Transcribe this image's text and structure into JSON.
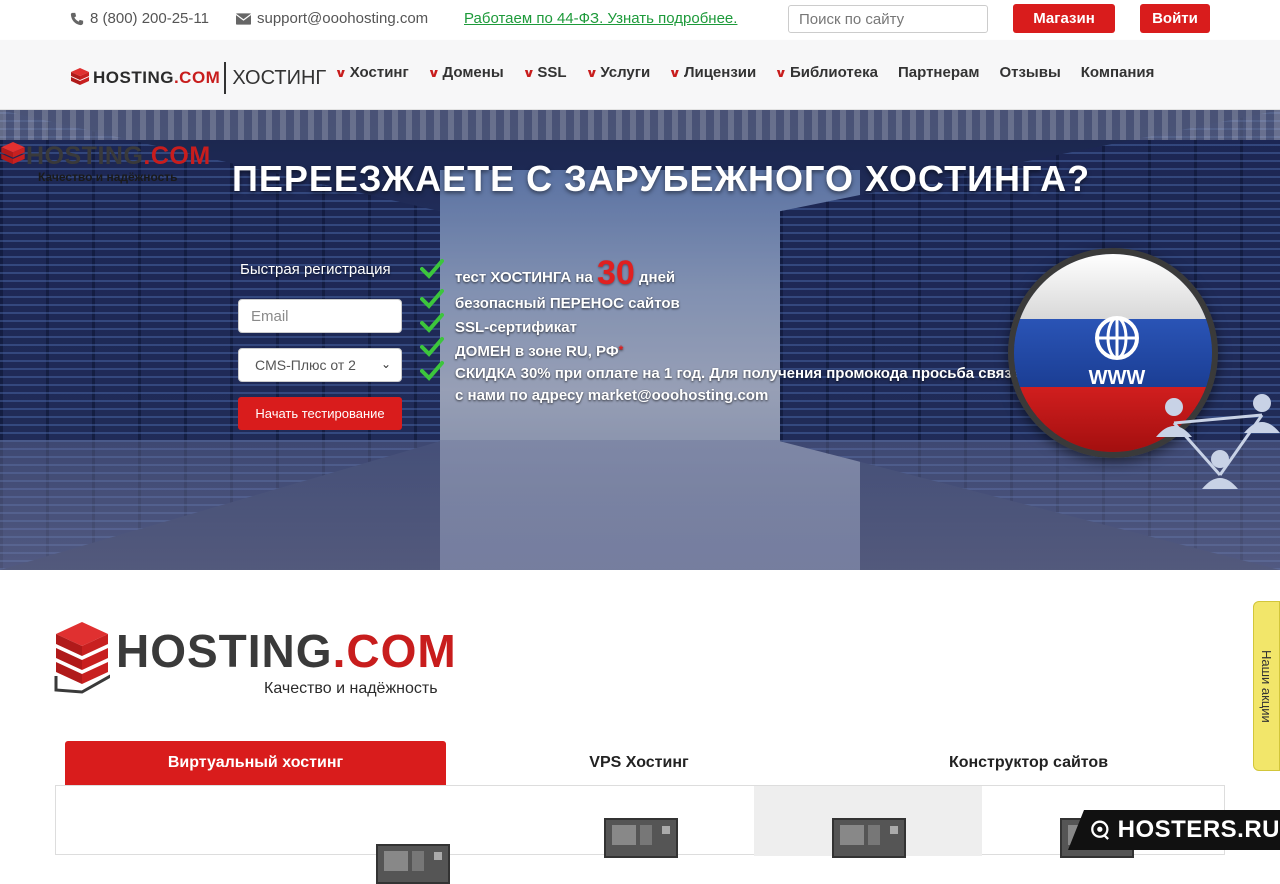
{
  "topbar": {
    "phone": "8 (800) 200-25-11",
    "email": "support@ooohosting.com",
    "law_link": "Работаем по 44-ФЗ. Узнать подробнее.",
    "search_placeholder": "Поиск по сайту",
    "shop_label": "Магазин",
    "login_label": "Войти"
  },
  "nav": {
    "logo_brand": "HOSTING",
    "logo_domain": ".COM",
    "logo_subtitle": "ХОСТИНГ",
    "items": [
      {
        "label": "Хостинг",
        "dropdown": true
      },
      {
        "label": "Домены",
        "dropdown": true
      },
      {
        "label": "SSL",
        "dropdown": true
      },
      {
        "label": "Услуги",
        "dropdown": true
      },
      {
        "label": "Лицензии",
        "dropdown": true
      },
      {
        "label": "Библиотека",
        "dropdown": true
      },
      {
        "label": "Партнерам",
        "dropdown": false
      },
      {
        "label": "Отзывы",
        "dropdown": false
      },
      {
        "label": "Компания",
        "dropdown": false
      }
    ]
  },
  "hero": {
    "logo_brand": "HOSTING",
    "logo_domain": ".COM",
    "logo_tagline": "Качество и надёжность",
    "title": "ПЕРЕЕЗЖАЕТЕ С ЗАРУБЕЖНОГО ХОСТИНГА?",
    "form": {
      "label": "Быстрая регистрация",
      "email_placeholder": "Email",
      "plan_value": "CMS-Плюс от 2",
      "submit_label": "Начать тестирование"
    },
    "features": {
      "f1_prefix": "тест ХОСТИНГА на",
      "f1_number": "30",
      "f1_suffix": "дней",
      "f2": "безопасный ПЕРЕНОС сайтов",
      "f3": "SSL-сертификат",
      "f4": "ДОМЕН в зоне RU, РФ",
      "f4_mark": "*",
      "f5_line1": "СКИДКА 30% при оплате на 1 год. Для получения промокода просьба связаться",
      "f5_line2": "с нами по адресу market@ooohosting.com"
    },
    "globe_text": "WWW",
    "colors": {
      "accent": "#d91c1c",
      "check": "#3cc63c"
    }
  },
  "brand_section": {
    "logo_brand": "HOSTING",
    "logo_domain": ".COM",
    "tagline": "Качество и надёжность"
  },
  "tabs": [
    {
      "label": "Виртуальный хостинг",
      "active": true
    },
    {
      "label": "VPS Хостинг",
      "active": false
    },
    {
      "label": "Конструктор сайтов",
      "active": false
    }
  ],
  "promo_tab": "Наши акции",
  "watermark": "HOSTERS.RU"
}
